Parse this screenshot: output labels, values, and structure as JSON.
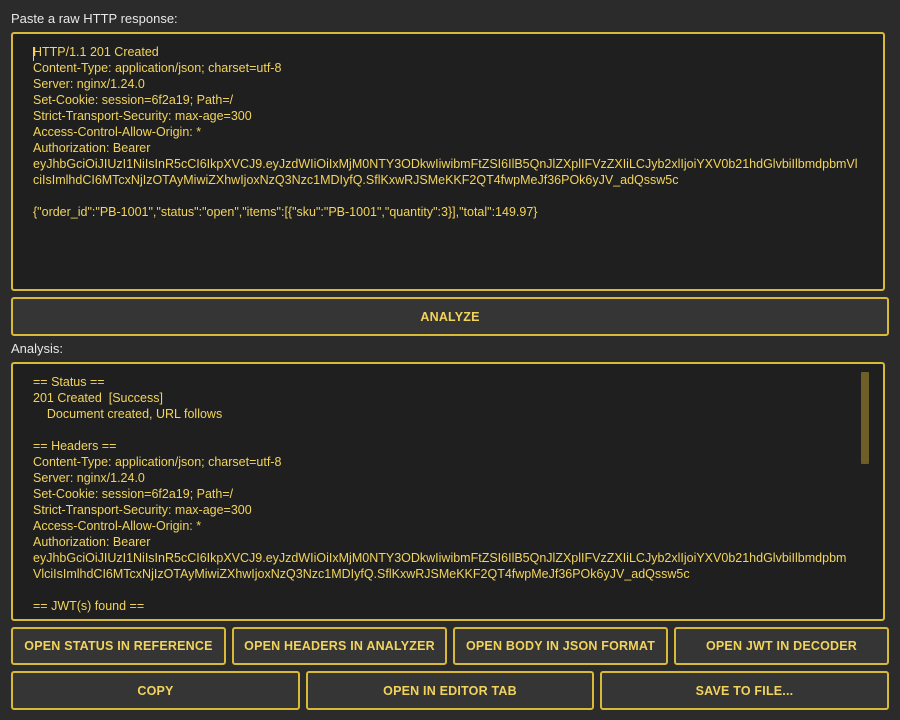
{
  "input_label": "Paste a raw HTTP response:",
  "raw_response": "HTTP/1.1 201 Created\nContent-Type: application/json; charset=utf-8\nServer: nginx/1.24.0\nSet-Cookie: session=6f2a19; Path=/\nStrict-Transport-Security: max-age=300\nAccess-Control-Allow-Origin: *\nAuthorization: Bearer\neyJhbGciOiJIUzI1NiIsInR5cCI6IkpXVCJ9.eyJzdWIiOiIxMjM0NTY3ODkwIiwibmFtZSI6IlB5QnJlZXplIFVzZXIiLCJyb2xlIjoiYXV0b21hdGlvbiIlbmdpbmVlciIsImlhdCI6MTcxNjIzOTAyMiwiZXhwIjoxNzQ3Nzc1MDIyfQ.SflKxwRJSMeKKF2QT4fwpMeJf36POk6yJV_adQssw5c\n\n{\"order_id\":\"PB-1001\",\"status\":\"open\",\"items\":[{\"sku\":\"PB-1001\",\"quantity\":3}],\"total\":149.97}",
  "analyze_label": "ANALYZE",
  "analysis_label": "Analysis:",
  "analysis_text": "== Status ==\n201 Created  [Success]\n    Document created, URL follows\n\n== Headers ==\nContent-Type: application/json; charset=utf-8\nServer: nginx/1.24.0\nSet-Cookie: session=6f2a19; Path=/\nStrict-Transport-Security: max-age=300\nAccess-Control-Allow-Origin: *\nAuthorization: Bearer\neyJhbGciOiJIUzI1NiIsInR5cCI6IkpXVCJ9.eyJzdWIiOiIxMjM0NTY3ODkwIiwibmFtZSI6IlB5QnJlZXplIFVzZXIiLCJyb2xlIjoiYXV0b21hdGlvbiIlbmdpbmVlciIsImlhdCI6MTcxNjIzOTAyMiwiZXhwIjoxNzQ3Nzc1MDIyfQ.SflKxwRJSMeKKF2QT4fwpMeJf36POk6yJV_adQssw5c\n\n== JWT(s) found ==",
  "buttons_row1": {
    "status_ref": "OPEN STATUS IN REFERENCE",
    "headers_analyzer": "OPEN HEADERS IN ANALYZER",
    "body_json": "OPEN BODY IN JSON FORMAT",
    "jwt_decoder": "OPEN JWT IN DECODER"
  },
  "buttons_row2": {
    "copy": "COPY",
    "editor_tab": "OPEN IN EDITOR TAB",
    "save_file": "SAVE TO FILE..."
  },
  "colors": {
    "accent": "#d9b938",
    "text": "#f2d45c",
    "background": "#2b2b2b",
    "panel": "#1f1f1f"
  }
}
